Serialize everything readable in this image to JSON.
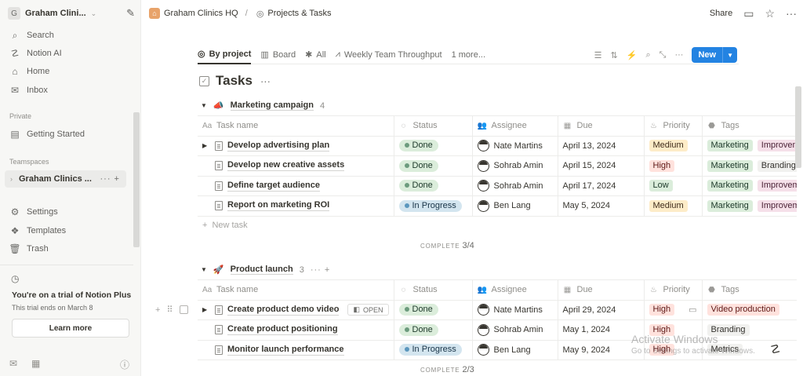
{
  "sidebar": {
    "workspace_initial": "G",
    "workspace_name": "Graham Clini...",
    "nav": [
      {
        "label": "Search",
        "icon": "search-icon"
      },
      {
        "label": "Notion AI",
        "icon": "notion-ai-icon"
      },
      {
        "label": "Home",
        "icon": "home-icon"
      },
      {
        "label": "Inbox",
        "icon": "inbox-icon"
      }
    ],
    "private_label": "Private",
    "getting_started": "Getting Started",
    "teamspaces_label": "Teamspaces",
    "teamspace": "Graham Clinics ...",
    "bottom_nav": [
      {
        "label": "Settings",
        "icon": "settings-icon"
      },
      {
        "label": "Templates",
        "icon": "templates-icon"
      },
      {
        "label": "Trash",
        "icon": "trash-icon"
      }
    ],
    "trial_title": "You're on a trial of Notion Plus",
    "trial_sub": "This trial ends on March 8",
    "learn_more": "Learn more"
  },
  "topbar": {
    "crumb_1": "Graham Clinics HQ",
    "crumb_sep": "/",
    "crumb_2": "Projects & Tasks",
    "share": "Share"
  },
  "views": {
    "tabs": [
      "By project",
      "Board",
      "All",
      "Weekly Team Throughput"
    ],
    "more": "1 more...",
    "new_label": "New"
  },
  "db_title": "Tasks",
  "columns": {
    "task": "Task name",
    "status": "Status",
    "assignee": "Assignee",
    "due": "Due",
    "priority": "Priority",
    "tags": "Tags"
  },
  "groups": [
    {
      "name": "Marketing campaign",
      "count": "4",
      "complete_label": "COMPLETE",
      "complete_value": "3/4",
      "rows": [
        {
          "task": "Develop advertising plan",
          "status": "Done",
          "assignee": "Nate Martins",
          "due": "April 13, 2024",
          "priority": "Medium",
          "tags": [
            "Marketing",
            "Improvem"
          ]
        },
        {
          "task": "Develop new creative assets",
          "status": "Done",
          "assignee": "Sohrab Amin",
          "due": "April 15, 2024",
          "priority": "High",
          "tags": [
            "Marketing",
            "Branding"
          ]
        },
        {
          "task": "Define target audience",
          "status": "Done",
          "assignee": "Sohrab Amin",
          "due": "April 17, 2024",
          "priority": "Low",
          "tags": [
            "Marketing",
            "Improvem"
          ]
        },
        {
          "task": "Report on marketing ROI",
          "status": "In Progress",
          "assignee": "Ben Lang",
          "due": "May 5, 2024",
          "priority": "Medium",
          "tags": [
            "Marketing",
            "Improvem"
          ]
        }
      ]
    },
    {
      "name": "Product launch",
      "count": "3",
      "complete_label": "COMPLETE",
      "complete_value": "2/3",
      "rows": [
        {
          "task": "Create product demo video",
          "status": "Done",
          "assignee": "Nate Martins",
          "due": "April 29, 2024",
          "priority": "High",
          "tags": [
            "Video production"
          ]
        },
        {
          "task": "Create product positioning",
          "status": "Done",
          "assignee": "Sohrab Amin",
          "due": "May 1, 2024",
          "priority": "High",
          "tags": [
            "Branding"
          ]
        },
        {
          "task": "Monitor launch performance",
          "status": "In Progress",
          "assignee": "Ben Lang",
          "due": "May 9, 2024",
          "priority": "High",
          "tags": [
            "Metrics"
          ]
        }
      ]
    }
  ],
  "new_task": "New task",
  "open_label": "OPEN",
  "watermark": {
    "line1": "Activate Windows",
    "line2": "Go to Settings to activate Windows."
  }
}
